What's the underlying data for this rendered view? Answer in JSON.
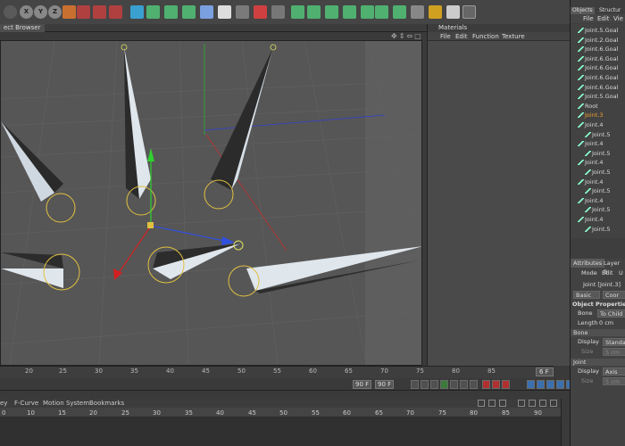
{
  "viewport_tab": {
    "label": "ect Browser"
  },
  "materials": {
    "title": "Materials",
    "menu": [
      "File",
      "Edit",
      "Function",
      "Texture"
    ]
  },
  "timeline_ruler_top": {
    "ticks": [
      "20",
      "25",
      "30",
      "35",
      "40",
      "45",
      "50",
      "55",
      "60",
      "65",
      "70",
      "75",
      "80",
      "85"
    ],
    "frame": "6 F"
  },
  "transport": {
    "start_frame": "90 F",
    "end_frame": "90 F"
  },
  "timeline": {
    "menu": [
      "ey",
      "F-Curve",
      "Motion System",
      "Bookmarks"
    ],
    "ticks": [
      "0",
      "10",
      "15",
      "20",
      "25",
      "30",
      "35",
      "40",
      "45",
      "50",
      "55",
      "60",
      "65",
      "70",
      "75",
      "80",
      "85",
      "90"
    ]
  },
  "objects_panel": {
    "tabs": [
      "Objects",
      "Structur"
    ],
    "menu": [
      "File",
      "Edit",
      "Vie"
    ],
    "items": [
      {
        "label": "Joint.5.Goal",
        "indent": 0
      },
      {
        "label": "Joint.2.Goal",
        "indent": 0
      },
      {
        "label": "Joint.6.Goal",
        "indent": 0
      },
      {
        "label": "Joint.6.Goal",
        "indent": 0
      },
      {
        "label": "Joint.6.Goal",
        "indent": 0
      },
      {
        "label": "Joint.6.Goal",
        "indent": 0
      },
      {
        "label": "Joint.6.Goal",
        "indent": 0
      },
      {
        "label": "Joint.5.Goal",
        "indent": 0
      },
      {
        "label": "Root",
        "indent": 0
      },
      {
        "label": "Joint.3",
        "indent": 0,
        "selected": true
      },
      {
        "label": "Joint.4",
        "indent": 0
      },
      {
        "label": "Joint.5",
        "indent": 1
      },
      {
        "label": "Joint.4",
        "indent": 0
      },
      {
        "label": "Joint.5",
        "indent": 1
      },
      {
        "label": "Joint.4",
        "indent": 0
      },
      {
        "label": "Joint.5",
        "indent": 1
      },
      {
        "label": "Joint.4",
        "indent": 0
      },
      {
        "label": "Joint.5",
        "indent": 1
      },
      {
        "label": "Joint.4",
        "indent": 0
      },
      {
        "label": "Joint.5",
        "indent": 1
      },
      {
        "label": "Joint.4",
        "indent": 0
      },
      {
        "label": "Joint.5",
        "indent": 1
      }
    ]
  },
  "attributes_panel": {
    "tabs": [
      "Attributes",
      "Layer B"
    ],
    "menu": [
      "Mode",
      "Edit",
      "U"
    ],
    "object_line": "Joint [Joint.3]",
    "subtabs": [
      "Basic",
      "Coor"
    ],
    "section_title": "Object Properties",
    "bone_label": "Bone",
    "bone_value": "To Child",
    "length_label": "Length",
    "length_value": "0 cm",
    "bone_group": "Bone",
    "display_label": "Display",
    "display_value": "Standa",
    "size_label": "Size",
    "size_value": "5 cm",
    "joint_group": "Joint",
    "joint_display_label": "Display",
    "joint_display_value": "Axis",
    "joint_size_label": "Size",
    "joint_size_value": "5 cm"
  },
  "colors": {
    "selected": "#f0a030",
    "axis_x": "#d02020",
    "axis_y": "#20c020",
    "axis_z": "#3050e0"
  }
}
